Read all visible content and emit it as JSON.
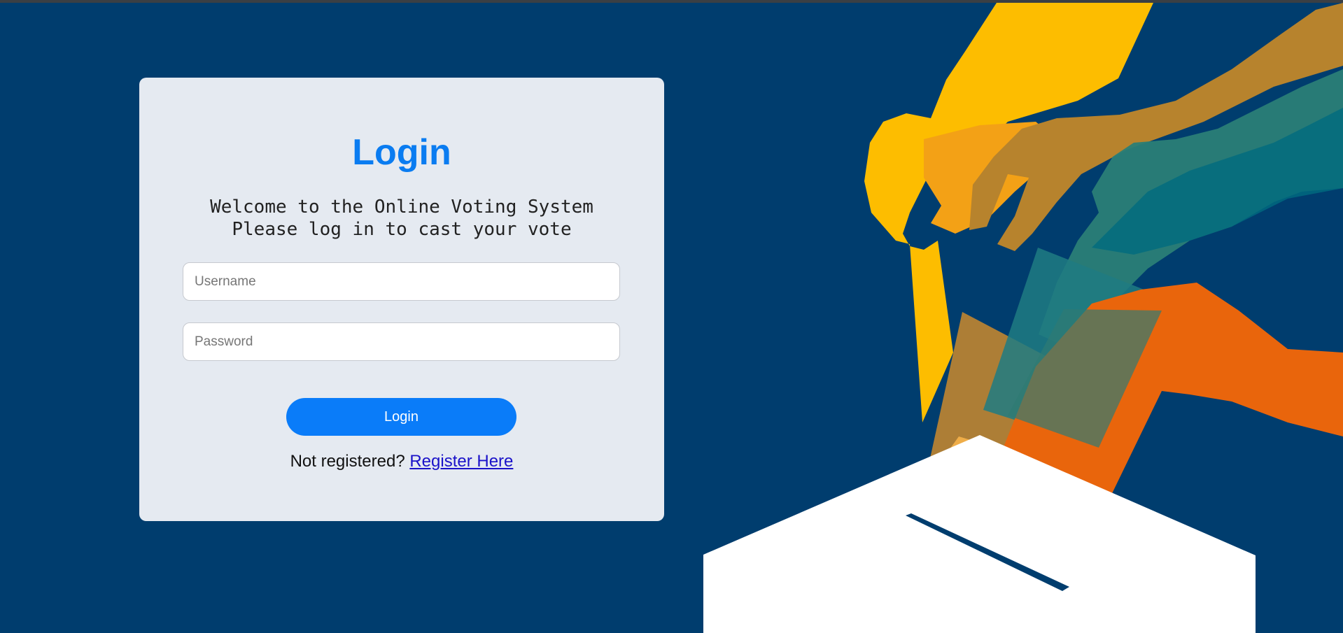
{
  "login": {
    "title": "Login",
    "welcome_line1": "Welcome to the Online Voting System",
    "welcome_line2": "Please log in to cast your vote",
    "username_placeholder": "Username",
    "password_placeholder": "Password",
    "login_button": "Login",
    "not_registered_text": "Not registered? ",
    "register_link": "Register Here"
  },
  "colors": {
    "background": "#003d6e",
    "card": "#e5eaf1",
    "accent": "#0a7cf9",
    "link": "#1a12c9"
  },
  "illustration": {
    "icon": "ballot-box-voting-hands-illustration"
  }
}
